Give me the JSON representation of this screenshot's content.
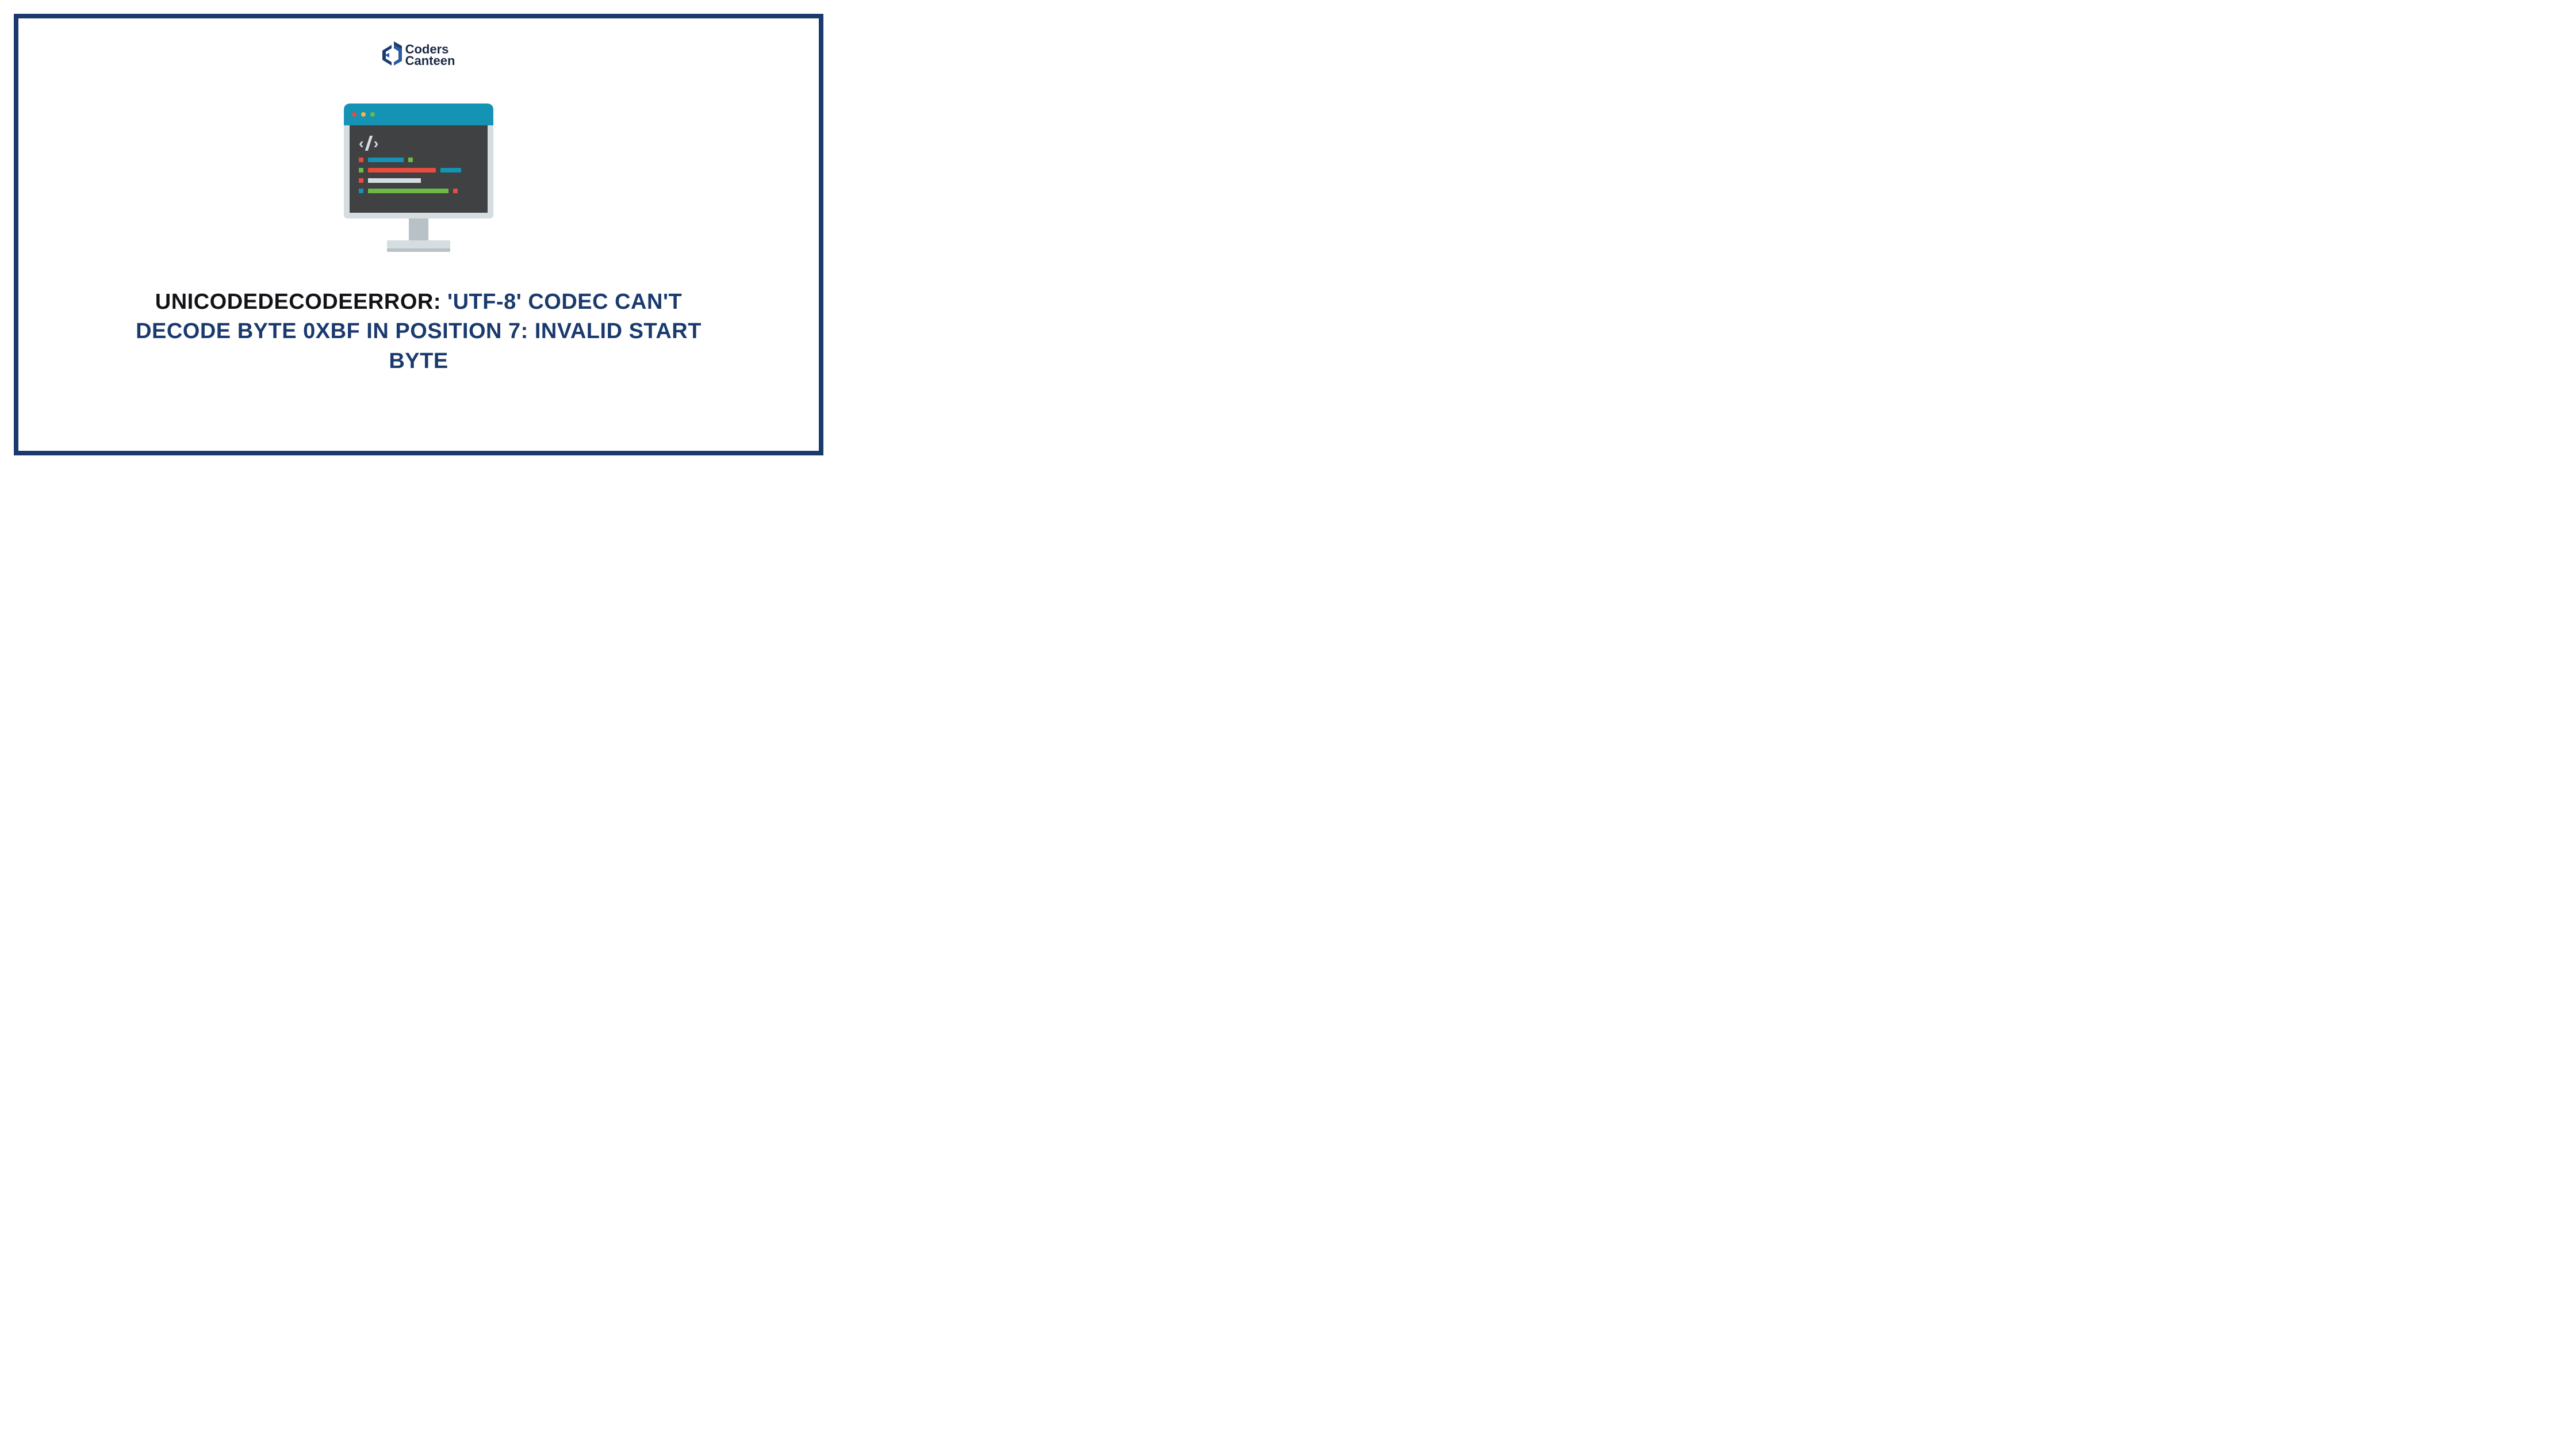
{
  "logo": {
    "line1": "Coders",
    "line2": "Canteen"
  },
  "headline": {
    "part1": "UNICODEDECODEERROR:",
    "part2": "'UTF-8' CODEC CAN'T DECODE BYTE 0XBF IN POSITION 7: INVALID START BYTE"
  },
  "colors": {
    "border": "#1a3a6e",
    "titlebar": "#1593b5",
    "screen": "#3f4143",
    "red": "#e74c3c",
    "green": "#6dbb45",
    "blue_seg": "#1593b5",
    "light": "#d5dde0"
  }
}
